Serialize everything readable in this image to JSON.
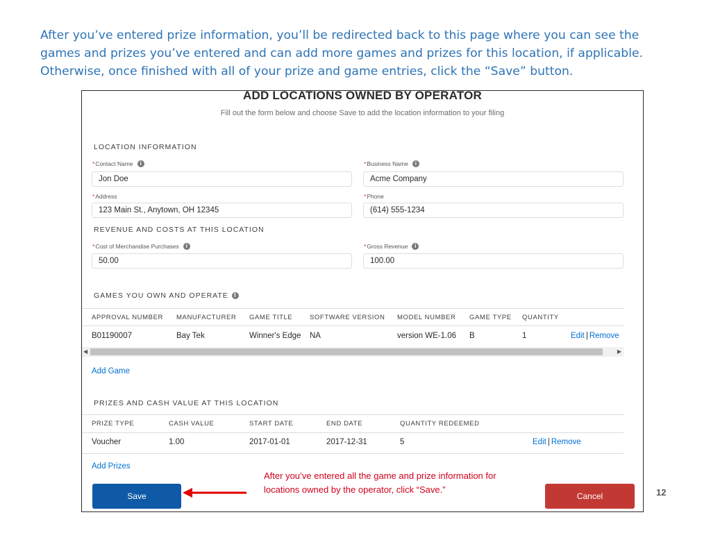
{
  "intro_text": "After you’ve entered prize information, you’ll be redirected back to this page where you can see the games and prizes you’ve entered and can add more games and prizes for this location, if applicable. Otherwise, once finished with all of your prize and game entries, click the “Save” button.",
  "form": {
    "title": "ADD LOCATIONS OWNED BY OPERATOR",
    "subtitle": "Fill out the form below and choose Save to add the location information to your filing"
  },
  "location": {
    "heading": "LOCATION INFORMATION",
    "contact_name": {
      "label": "Contact Name",
      "value": "Jon Doe"
    },
    "business_name": {
      "label": "Business Name",
      "value": "Acme Company"
    },
    "address": {
      "label": "Address",
      "value": "123 Main St., Anytown, OH 12345"
    },
    "phone": {
      "label": "Phone",
      "value": "(614) 555-1234"
    }
  },
  "revenue": {
    "heading": "REVENUE AND COSTS AT THIS LOCATION",
    "cost": {
      "label": "Cost of Merchandise Purchases",
      "value": "50.00"
    },
    "gross": {
      "label": "Gross Revenue",
      "value": "100.00"
    }
  },
  "games": {
    "heading": "GAMES YOU OWN AND OPERATE",
    "columns": [
      "APPROVAL NUMBER",
      "MANUFACTURER",
      "GAME TITLE",
      "SOFTWARE VERSION",
      "MODEL NUMBER",
      "GAME TYPE",
      "QUANTITY"
    ],
    "row": {
      "approval": "B01190007",
      "manufacturer": "Bay Tek",
      "title": "Winner's Edge",
      "software": "NA",
      "model": "version WE-1.06",
      "type": "B",
      "quantity": "1"
    },
    "edit_label": "Edit",
    "remove_label": "Remove",
    "add_label": "Add Game"
  },
  "prizes": {
    "heading": "PRIZES AND CASH VALUE AT THIS LOCATION",
    "columns": [
      "PRIZE TYPE",
      "CASH VALUE",
      "START DATE",
      "END DATE",
      "QUANTITY REDEEMED"
    ],
    "row": {
      "type": "Voucher",
      "cash": "1.00",
      "start": "2017-01-01",
      "end": "2017-12-31",
      "quantity": "5"
    },
    "edit_label": "Edit",
    "remove_label": "Remove",
    "add_label": "Add Prizes"
  },
  "buttons": {
    "save": "Save",
    "cancel": "Cancel"
  },
  "annotation": "After you’ve entered all the game and prize information for locations owned by the operator, click “Save.”",
  "page_number": "12",
  "colors": {
    "link": "#0070d2",
    "save": "#0e5aa7",
    "cancel": "#c23934",
    "annotation": "#d0021b",
    "intro": "#2e74b5"
  }
}
